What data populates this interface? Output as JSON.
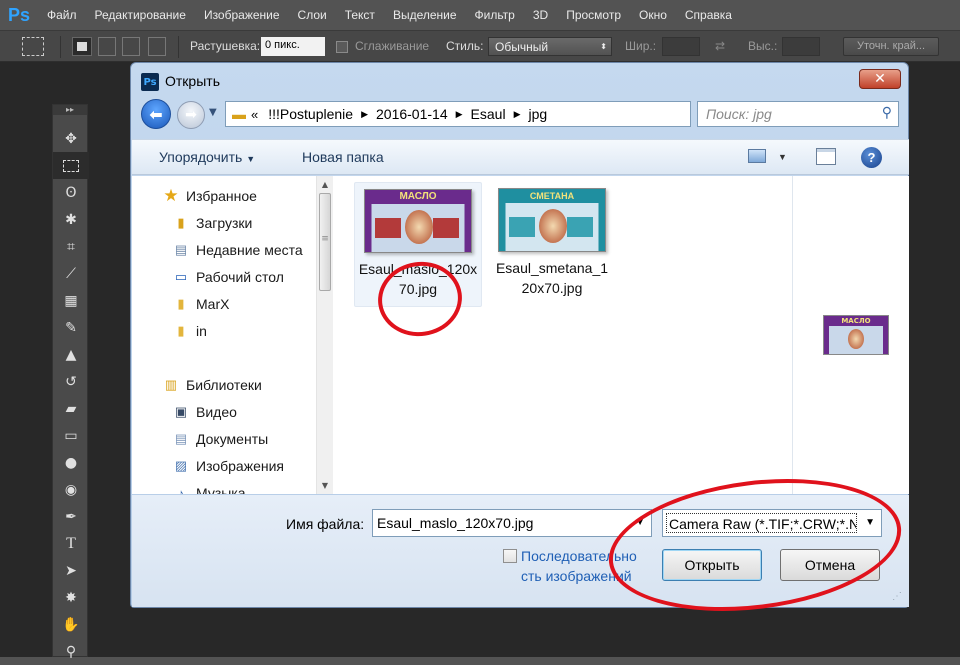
{
  "app": {
    "logo": "Ps",
    "menu": [
      "Файл",
      "Редактирование",
      "Изображение",
      "Слои",
      "Текст",
      "Выделение",
      "Фильтр",
      "3D",
      "Просмотр",
      "Окно",
      "Справка"
    ]
  },
  "options": {
    "feather_label": "Растушевка:",
    "feather_value": "0 пикс.",
    "antialias_label": "Сглаживание",
    "style_label": "Стиль:",
    "style_value": "Обычный",
    "width_label": "Шир.:",
    "height_label": "Выс.:",
    "refine_label": "Уточн. край..."
  },
  "dialog": {
    "title": "Открыть",
    "close": "✕",
    "breadcrumb": [
      "«",
      "!!!Postuplenie",
      "2016-01-14",
      "Esaul",
      "jpg"
    ],
    "search_placeholder": "Поиск: jpg",
    "organize_label": "Упорядочить",
    "new_folder_label": "Новая папка",
    "nav": {
      "favorites": "Избранное",
      "downloads": "Загрузки",
      "recent": "Недавние места",
      "desktop": "Рабочий стол",
      "marx": "MarX",
      "in": "in",
      "libraries": "Библиотеки",
      "video": "Видео",
      "documents": "Документы",
      "images": "Изображения",
      "music": "Музыка"
    },
    "files": [
      {
        "name": "Esaul_maslo_120x70.jpg",
        "label_line1": "Esaul_maslo_120x",
        "label_line2": "70.jpg",
        "thumb_text": "МАСЛО",
        "selected": true
      },
      {
        "name": "Esaul_smetana_120x70.jpg",
        "label_line1": "Esaul_smetana_1",
        "label_line2": "20x70.jpg",
        "thumb_text": "СМЕТАНА",
        "selected": false
      }
    ],
    "preview_text": "МАСЛО",
    "filename_label": "Имя файла:",
    "filename_value": "Esaul_maslo_120x70.jpg",
    "filetype_value": "Camera Raw (*.TIF;*.CRW;*.N",
    "sequence_line1": "Последовательно",
    "sequence_line2": "сть изображений",
    "open_button": "Открыть",
    "cancel_button": "Отмена"
  },
  "colors": {
    "annotation_ring": "#e0121c",
    "maslo_frame": "#6a2b8c",
    "smetana_frame": "#1f8fa0"
  }
}
